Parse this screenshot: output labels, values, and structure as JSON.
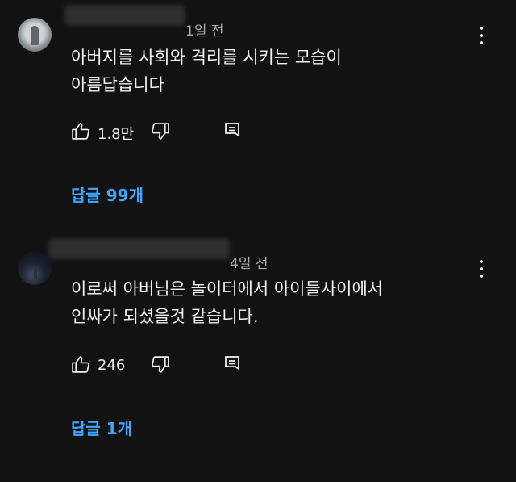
{
  "comments": [
    {
      "time": "1일 전",
      "text": "아버지를 사회와 격리를 시키는 모습이\n아름답습니다",
      "likes": "1.8만",
      "replies": "답글 99개"
    },
    {
      "time": "4일 전",
      "text": "이로써 아버님은 놀이터에서 아이들사이에서\n인싸가 되셨을것 같습니다.",
      "likes": "246",
      "replies": "답글 1개"
    }
  ],
  "icons": {
    "like": "thumbs-up-icon",
    "dislike": "thumbs-down-icon",
    "reply": "comment-icon",
    "menu": "more-vert-icon"
  },
  "colors": {
    "background": "#121212",
    "link": "#3ea6ff",
    "meta": "#aaaaaa"
  }
}
